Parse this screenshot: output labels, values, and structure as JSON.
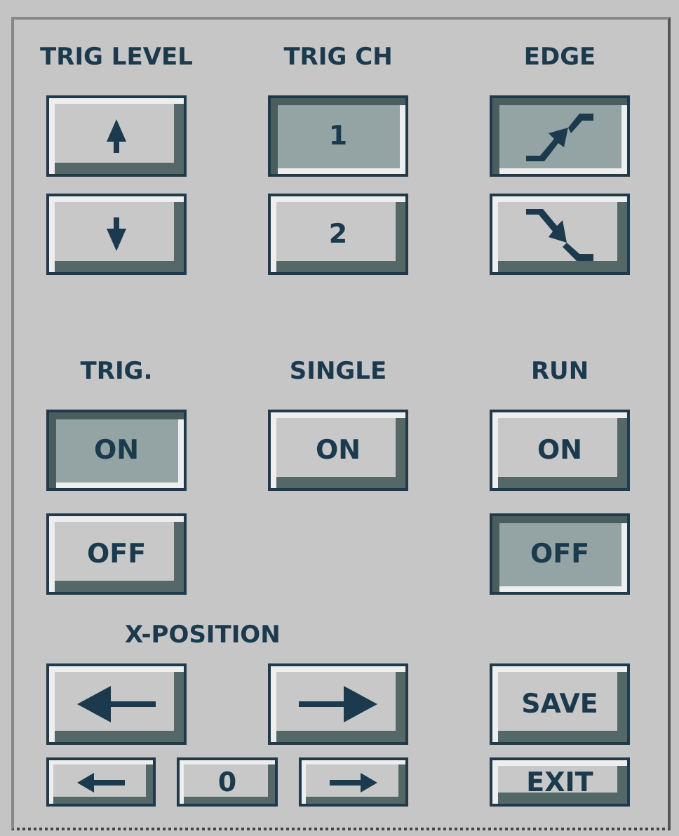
{
  "trig_level": {
    "label": "TRIG LEVEL",
    "buttons": [
      {
        "kind": "up",
        "selected": false
      },
      {
        "kind": "down",
        "selected": false
      }
    ]
  },
  "trig_ch": {
    "label": "TRIG CH",
    "buttons": [
      {
        "text": "1",
        "selected": true
      },
      {
        "text": "2",
        "selected": false
      }
    ]
  },
  "edge": {
    "label": "EDGE",
    "buttons": [
      {
        "kind": "rising",
        "selected": true
      },
      {
        "kind": "falling",
        "selected": false
      }
    ]
  },
  "trig": {
    "label": "TRIG.",
    "buttons": [
      {
        "text": "ON",
        "selected": true
      },
      {
        "text": "OFF",
        "selected": false
      }
    ]
  },
  "single": {
    "label": "SINGLE",
    "buttons": [
      {
        "text": "ON",
        "selected": false
      }
    ]
  },
  "run": {
    "label": "RUN",
    "buttons": [
      {
        "text": "ON",
        "selected": false
      },
      {
        "text": "OFF",
        "selected": true
      }
    ]
  },
  "x_position": {
    "label": "X-POSITION",
    "large_buttons": [
      {
        "kind": "left"
      },
      {
        "kind": "right"
      }
    ],
    "small_left": {
      "kind": "left"
    },
    "value": "0",
    "small_right": {
      "kind": "right"
    }
  },
  "save": {
    "text": "SAVE"
  },
  "exit": {
    "text": "EXIT"
  }
}
